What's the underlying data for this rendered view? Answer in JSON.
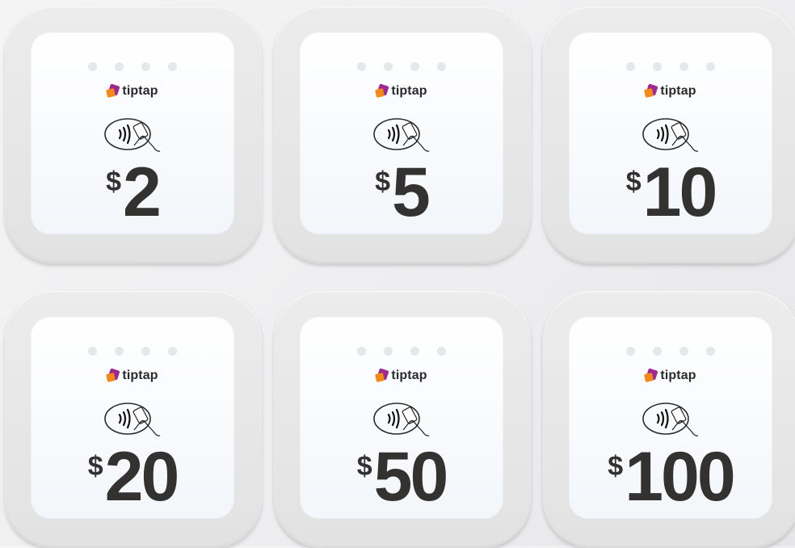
{
  "brand": {
    "name": "tiptap",
    "colors": {
      "mark_back": "#9d2a8e",
      "mark_front": "#f08a1c",
      "amount_text": "#343131"
    }
  },
  "icons": {
    "logo": "tiptap-logo-icon",
    "contactless": "contactless-tap-icon"
  },
  "devices": [
    {
      "currency": "$",
      "amount": "2"
    },
    {
      "currency": "$",
      "amount": "5"
    },
    {
      "currency": "$",
      "amount": "10"
    },
    {
      "currency": "$",
      "amount": "20"
    },
    {
      "currency": "$",
      "amount": "50"
    },
    {
      "currency": "$",
      "amount": "100"
    }
  ]
}
